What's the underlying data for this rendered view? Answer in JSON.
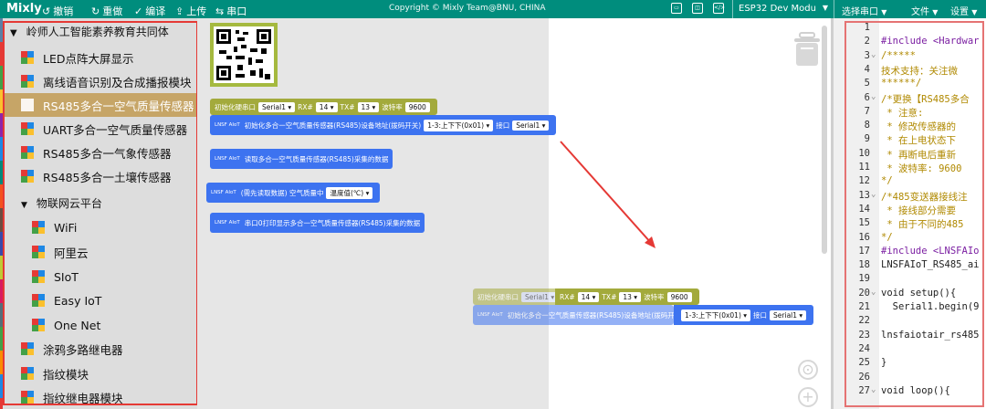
{
  "app": {
    "logo": "Mixly",
    "toolbar": {
      "undo": "撤销",
      "redo": "重做",
      "compile": "编译",
      "upload": "上传",
      "serial": "串口"
    },
    "copyright": "Copyright © Mixly Team@BNU, CHINA",
    "board": "ESP32 Dev Modu",
    "port_select": "选择串口",
    "file_menu": "文件",
    "settings_menu": "设置",
    "view_icons": [
      "layout-icon",
      "split-icon",
      "code-view-icon"
    ],
    "accent_color": "#008d7d"
  },
  "toolbox": {
    "root": "岭师人工智能素养教育共同体",
    "items": [
      {
        "label": "LED点阵大屏显示"
      },
      {
        "label": "离线语音识别及合成播报模块"
      },
      {
        "label": "RS485多合一空气质量传感器",
        "selected": true
      },
      {
        "label": "UART多合一空气质量传感器"
      },
      {
        "label": "RS485多合一气象传感器"
      },
      {
        "label": "RS485多合一土壤传感器"
      }
    ],
    "subtree": "物联网云平台",
    "sub_items": [
      {
        "label": "WiFi"
      },
      {
        "label": "阿里云"
      },
      {
        "label": "SIoT"
      },
      {
        "label": "Easy IoT"
      },
      {
        "label": "One Net"
      }
    ],
    "bottom_items": [
      {
        "label": "涂鸦多路继电器"
      },
      {
        "label": "指纹模块"
      },
      {
        "label": "指纹继电器模块"
      }
    ],
    "selected_color": "#c6a567"
  },
  "blocks": {
    "init_serial": {
      "label": "初始化硬串口",
      "serial": "Serial1",
      "rx_label": "RX#",
      "rx": "14",
      "tx_label": "TX#",
      "tx": "13",
      "baud_label": "波特率",
      "baud": "9600"
    },
    "init_sensor": {
      "tag": "LNSF AIoT",
      "label": "初始化多合一空气质量传感器(RS485)设备地址(拨码开关)",
      "addr": "1-3:上下下(0x01)",
      "port_label": "接口",
      "port": "Serial1"
    },
    "read_sensor": {
      "tag": "LNSF AIoT",
      "label": "读取多合一空气质量传感器(RS485)采集的数据"
    },
    "get_quality": {
      "tag": "LNSF AIoT",
      "label": "(需先读取数据) 空气质量中",
      "field": "温度值(℃)"
    },
    "print_data": {
      "tag": "LNSF AIoT",
      "label": "串口0打印显示多合一空气质量传感器(RS485)采集的数据"
    }
  },
  "editor": {
    "lines": [
      {
        "n": "1",
        "code": "",
        "cls": "c-txt"
      },
      {
        "n": "2",
        "code": "#include <Hardwar",
        "cls": "c-pre"
      },
      {
        "n": "3",
        "code": "/*****",
        "cls": "c-cmt",
        "fold": true
      },
      {
        "n": "4",
        "code": "技术支持：关注微",
        "cls": "c-cmt"
      },
      {
        "n": "5",
        "code": "******/",
        "cls": "c-cmt"
      },
      {
        "n": "6",
        "code": "/*更换【RS485多合",
        "cls": "c-cmt",
        "fold": true
      },
      {
        "n": "7",
        "code": " * 注意:",
        "cls": "c-cmt"
      },
      {
        "n": "8",
        "code": " * 修改传感器的",
        "cls": "c-cmt"
      },
      {
        "n": "9",
        "code": " * 在上电状态下",
        "cls": "c-cmt"
      },
      {
        "n": "10",
        "code": " * 再断电后重新",
        "cls": "c-cmt"
      },
      {
        "n": "11",
        "code": " * 波特率: 9600",
        "cls": "c-cmt"
      },
      {
        "n": "12",
        "code": "*/",
        "cls": "c-cmt"
      },
      {
        "n": "13",
        "code": "/*485变送器接线注",
        "cls": "c-cmt",
        "fold": true
      },
      {
        "n": "14",
        "code": " * 接线部分需要",
        "cls": "c-cmt"
      },
      {
        "n": "15",
        "code": " * 由于不同的485",
        "cls": "c-cmt"
      },
      {
        "n": "16",
        "code": "*/",
        "cls": "c-cmt"
      },
      {
        "n": "17",
        "code": "#include <LNSFAIo",
        "cls": "c-pre"
      },
      {
        "n": "18",
        "code": "LNSFAIoT_RS485_ai",
        "cls": "c-txt"
      },
      {
        "n": "19",
        "code": "",
        "cls": "c-txt"
      },
      {
        "n": "20",
        "code": "void setup(){",
        "cls": "c-txt",
        "fold": true
      },
      {
        "n": "21",
        "code": "  Serial1.begin(9",
        "cls": "c-txt"
      },
      {
        "n": "22",
        "code": "",
        "cls": "c-txt"
      },
      {
        "n": "23",
        "code": "lnsfaiotair_rs485",
        "cls": "c-txt"
      },
      {
        "n": "24",
        "code": "",
        "cls": "c-txt"
      },
      {
        "n": "25",
        "code": "}",
        "cls": "c-txt"
      },
      {
        "n": "26",
        "code": "",
        "cls": "c-txt"
      },
      {
        "n": "27",
        "code": "void loop(){",
        "cls": "c-txt",
        "fold": true
      }
    ]
  }
}
